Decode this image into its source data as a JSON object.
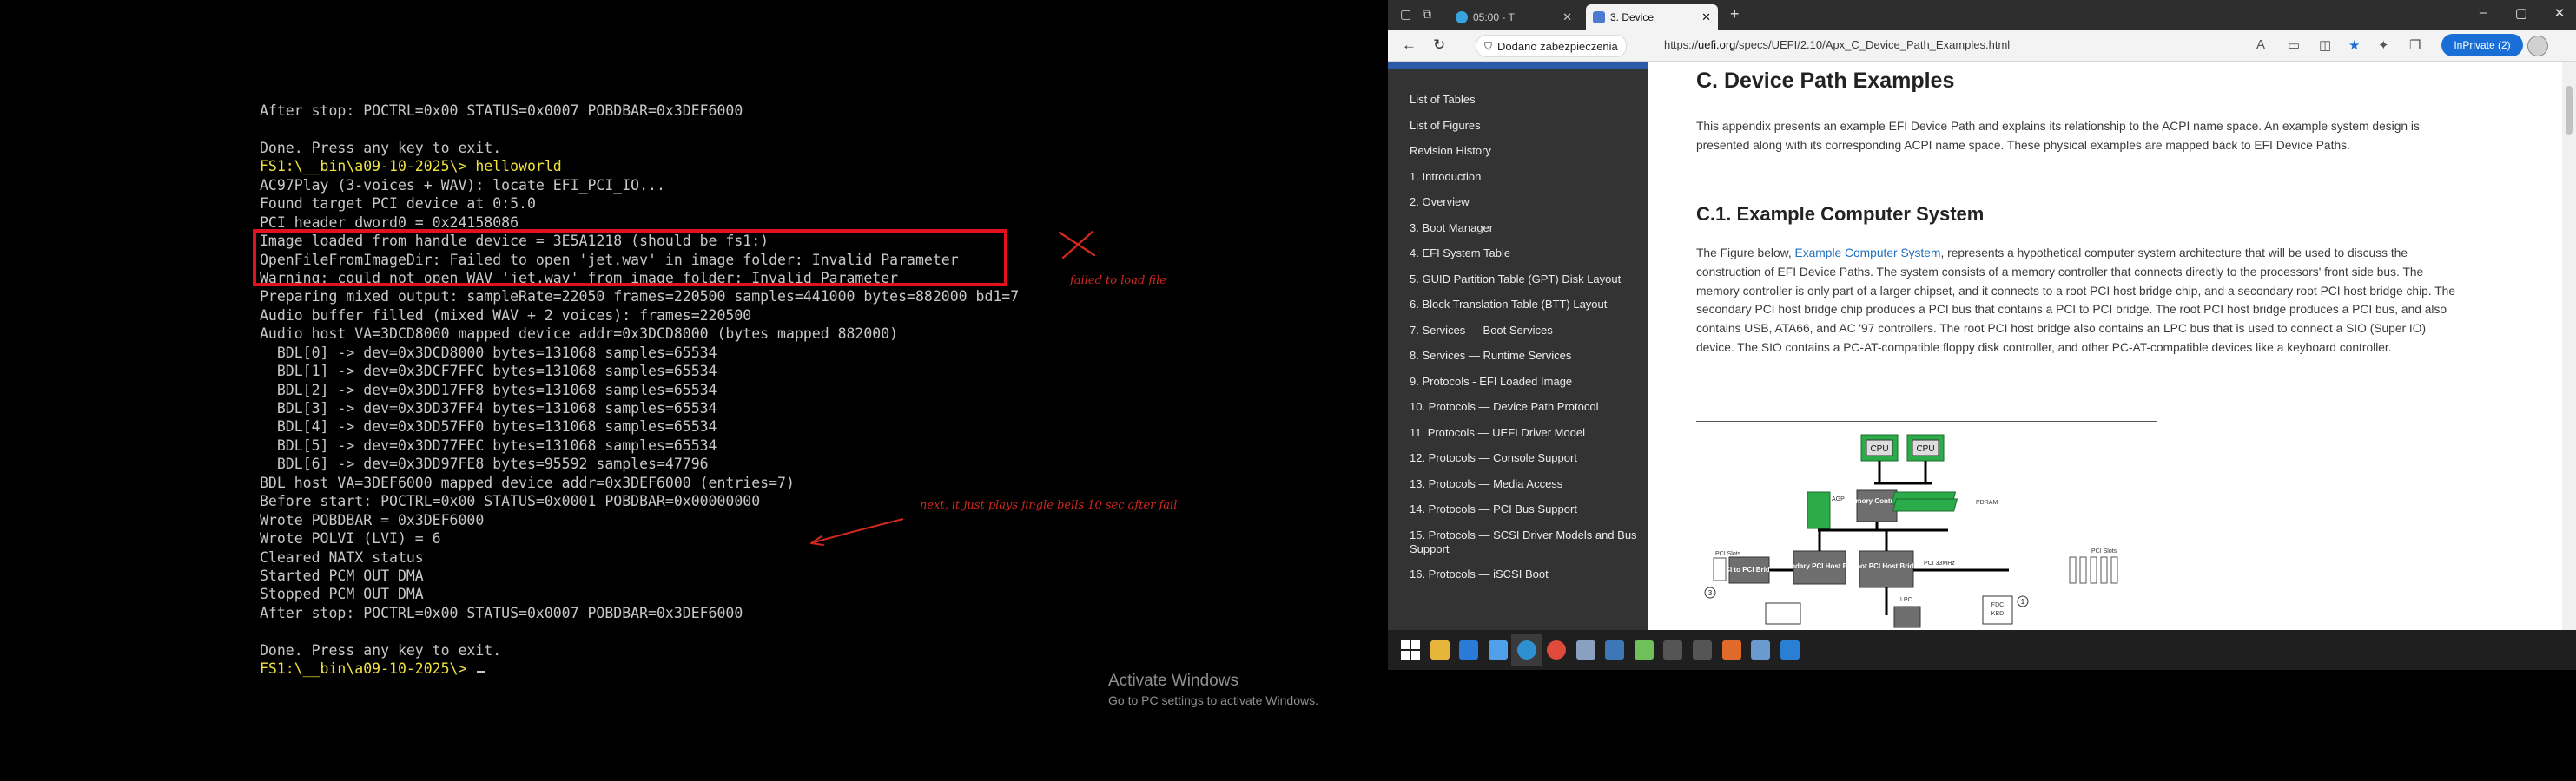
{
  "terminal": {
    "lines": [
      {
        "text": "After stop: POCTRL=0x00 STATUS=0x0007 POBDBAR=0x3DEF6000",
        "color": "white"
      },
      {
        "text": "",
        "color": "white"
      },
      {
        "text": "Done. Press any key to exit.",
        "color": "white"
      },
      {
        "text": "FS1:\\__bin\\a09-10-2025\\> helloworld",
        "color": "yellow-prompt"
      },
      {
        "text": "AC97Play (3-voices + WAV): locate EFI_PCI_IO...",
        "color": "white"
      },
      {
        "text": "Found target PCI device at 0:5.0",
        "color": "white"
      },
      {
        "text": "PCI header dword0 = 0x24158086",
        "color": "white"
      },
      {
        "text": "Image loaded from handle device = 3E5A1218 (should be fs1:)",
        "color": "white"
      },
      {
        "text": "OpenFileFromImageDir: Failed to open 'jet.wav' in image folder: Invalid Parameter",
        "color": "white"
      },
      {
        "text": "Warning: could not open WAV 'jet.wav' from image folder: Invalid Parameter",
        "color": "white"
      },
      {
        "text": "Preparing mixed output: sampleRate=22050 frames=220500 samples=441000 bytes=882000 bd1=7",
        "color": "white"
      },
      {
        "text": "Audio buffer filled (mixed WAV + 2 voices): frames=220500",
        "color": "white"
      },
      {
        "text": "Audio host VA=3DCD8000 mapped device addr=0x3DCD8000 (bytes mapped 882000)",
        "color": "white"
      },
      {
        "text": "  BDL[0] -> dev=0x3DCD8000 bytes=131068 samples=65534",
        "color": "white"
      },
      {
        "text": "  BDL[1] -> dev=0x3DCF7FFC bytes=131068 samples=65534",
        "color": "white"
      },
      {
        "text": "  BDL[2] -> dev=0x3DD17FF8 bytes=131068 samples=65534",
        "color": "white"
      },
      {
        "text": "  BDL[3] -> dev=0x3DD37FF4 bytes=131068 samples=65534",
        "color": "white"
      },
      {
        "text": "  BDL[4] -> dev=0x3DD57FF0 bytes=131068 samples=65534",
        "color": "white"
      },
      {
        "text": "  BDL[5] -> dev=0x3DD77FEC bytes=131068 samples=65534",
        "color": "white"
      },
      {
        "text": "  BDL[6] -> dev=0x3DD97FE8 bytes=95592 samples=47796",
        "color": "white"
      },
      {
        "text": "BDL host VA=3DEF6000 mapped device addr=0x3DEF6000 (entries=7)",
        "color": "white"
      },
      {
        "text": "Before start: POCTRL=0x00 STATUS=0x0001 POBDBAR=0x00000000",
        "color": "white"
      },
      {
        "text": "Wrote POBDBAR = 0x3DEF6000",
        "color": "white"
      },
      {
        "text": "Wrote POLVI (LVI) = 6",
        "color": "white"
      },
      {
        "text": "Cleared NATX status",
        "color": "white"
      },
      {
        "text": "Started PCM OUT DMA",
        "color": "white"
      },
      {
        "text": "Stopped PCM OUT DMA",
        "color": "white"
      },
      {
        "text": "After stop: POCTRL=0x00 STATUS=0x0007 POBDBAR=0x3DEF6000",
        "color": "white"
      },
      {
        "text": "",
        "color": "white"
      },
      {
        "text": "Done. Press any key to exit.",
        "color": "white"
      },
      {
        "text": "FS1:\\__bin\\a09-10-2025\\> ",
        "color": "yellow-prompt"
      }
    ],
    "annotations": {
      "failed_note": "failed to load file",
      "next_note": "next, it just plays jingle bells 10 sec  after fail"
    },
    "watermark": {
      "title": "Activate Windows",
      "subtitle": "Go to PC settings to activate Windows."
    },
    "colors": {
      "text": "#c8c8c8",
      "prompt": "#f2e33c",
      "annotation": "#d0281f"
    }
  },
  "browser": {
    "tabs": [
      {
        "label": "05:00 - T",
        "active": false
      },
      {
        "label": "3. Device",
        "active": true
      }
    ],
    "security_label": "Dodano zabezpieczenia",
    "url": "https://uefi.org/specs/UEFI/2.10/Apx_C_Device_Path_Examples.html",
    "inprivate_label": "InPrivate (2)",
    "accent": "#1a6fd6",
    "sidebar": {
      "items": [
        "List of Tables",
        "List of Figures",
        "Revision History",
        "1. Introduction",
        "2. Overview",
        "3. Boot Manager",
        "4. EFI System Table",
        "5. GUID Partition Table (GPT) Disk Layout",
        "6. Block Translation Table (BTT) Layout",
        "7. Services — Boot Services",
        "8. Services — Runtime Services",
        "9. Protocols - EFI Loaded Image",
        "10. Protocols — Device Path Protocol",
        "11. Protocols — UEFI Driver Model",
        "12. Protocols — Console Support",
        "13. Protocols — Media Access",
        "14. Protocols — PCI Bus Support",
        "15. Protocols — SCSI Driver Models and Bus Support",
        "16. Protocols — iSCSI Boot"
      ]
    },
    "content": {
      "title": "C. Device Path Examples",
      "intro": "This appendix presents an example EFI Device Path and explains its relationship to the ACPI name space. An example system design is presented along with its corresponding ACPI name space. These physical examples are mapped back to EFI Device Paths.",
      "section_title": "C.1. Example Computer System",
      "body_pre": "The Figure below, ",
      "body_link": "Example Computer System",
      "body_post": ", represents a hypothetical computer system architecture that will be used to discuss the construction of EFI Device Paths. The system consists of a memory controller that connects directly to the processors' front side bus. The memory controller is only part of a larger chipset, and it connects to a root PCI host bridge chip, and a secondary root PCI host bridge chip. The secondary PCI host bridge chip produces a PCI bus that contains a PCI to PCI bridge. The root PCI host bridge produces a PCI bus, and also contains USB, ATA66, and AC '97 controllers. The root PCI host bridge also contains an LPC bus that is used to connect a SIO (Super IO) device. The SIO contains a PC-AT-compatible floppy disk controller, and other PC-AT-compatible devices like a keyboard controller.",
      "figure": {
        "cpu_label": "CPU",
        "agp_label": "AGP",
        "memory_controller": "Memory Controller",
        "pdram": "PDRAM",
        "pci_slots": "PCI Slots",
        "pci_to_pci": "PCI to PCI Bridge",
        "secondary_bridge": "Secondary PCI Host Bridge",
        "root_bridge": "Root PCI Host Bridge",
        "pci_33": "PCI 33MHz",
        "lpc": "LPC",
        "fdc": "FDC",
        "kbd": "KBD",
        "num3": "3",
        "num1": "1"
      }
    }
  },
  "taskbar": {
    "apps": [
      "start-icon",
      "file-explorer-icon",
      "app-blue-icon",
      "app-search-icon",
      "edge-icon",
      "chrome-icon",
      "network-icon",
      "python-icon",
      "image-editor-icon",
      "terminal-icon",
      "terminal-icon-2",
      "orange-app-icon",
      "blue-book-icon",
      "vscode-icon"
    ]
  }
}
